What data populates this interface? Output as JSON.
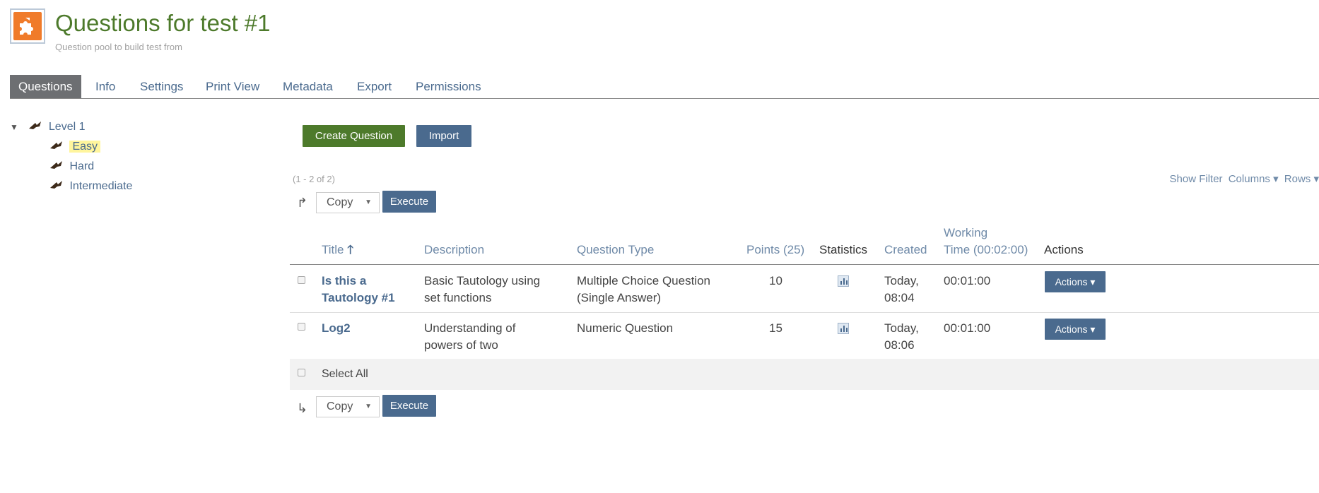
{
  "header": {
    "title": "Questions for test #1",
    "subtitle": "Question pool to build test from",
    "logo_icon": "puzzle-icon"
  },
  "tabs": [
    {
      "label": "Questions",
      "active": true
    },
    {
      "label": "Info"
    },
    {
      "label": "Settings"
    },
    {
      "label": "Print View"
    },
    {
      "label": "Metadata"
    },
    {
      "label": "Export"
    },
    {
      "label": "Permissions"
    }
  ],
  "tree": {
    "root": "Level 1",
    "children": [
      "Easy",
      "Hard",
      "Intermediate"
    ],
    "selected": "Easy"
  },
  "toolbar": {
    "create_label": "Create Question",
    "import_label": "Import"
  },
  "table_info": {
    "count": "(1 - 2 of 2)",
    "show_filter": "Show Filter",
    "columns": "Columns ▾",
    "rows": "Rows ▾"
  },
  "command_top": {
    "select_value": "Copy",
    "execute_label": "Execute"
  },
  "command_bottom": {
    "select_value": "Copy",
    "execute_label": "Execute"
  },
  "columns": {
    "title": "Title",
    "description": "Description",
    "question_type": "Question Type",
    "points": "Points (25)",
    "statistics": "Statistics",
    "created": "Created",
    "working_time_1": "Working",
    "working_time_2": "Time (00:02:00)",
    "actions": "Actions"
  },
  "rows": [
    {
      "title_1": "Is this a",
      "title_2": "Tautology #1",
      "description_1": "Basic Tautology using",
      "description_2": "set functions",
      "type_1": "Multiple Choice Question",
      "type_2": "(Single Answer)",
      "points": "10",
      "created_1": "Today,",
      "created_2": "08:04",
      "working_time": "00:01:00",
      "actions": "Actions ▾"
    },
    {
      "title_1": "Log2",
      "description_1": "Understanding of",
      "description_2": "powers of two",
      "type_1": "Numeric Question",
      "points": "15",
      "created_1": "Today,",
      "created_2": "08:06",
      "working_time": "00:01:00",
      "actions": "Actions ▾"
    }
  ],
  "select_all": "Select All",
  "colors": {
    "title_green": "#4d7a2b",
    "link_blue": "#4a6a8e",
    "tab_active_bg": "#6d6f72",
    "logo_orange": "#f07b2a"
  }
}
